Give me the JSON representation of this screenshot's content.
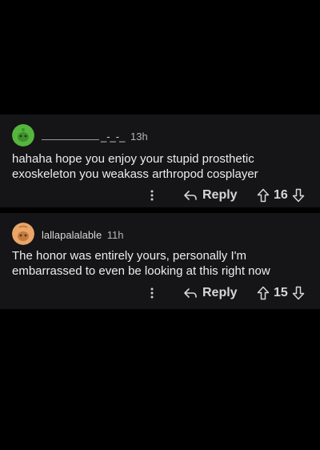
{
  "comments": [
    {
      "username": "_-_-_",
      "age": "13h",
      "text": "hahaha hope you enjoy your stupid prosthetic exoskeleton you weakass arthropod cosplayer",
      "reply_label": "Reply",
      "score": "16",
      "avatar_color": "#55b53d"
    },
    {
      "username": "lallapalalable",
      "age": "11h",
      "text": "The honor was entirely yours, personally I'm embarrassed to even be looking at this right now",
      "reply_label": "Reply",
      "score": "15",
      "avatar_color": "#e9a668"
    }
  ],
  "icons": {
    "more": "vertical-dots-icon",
    "reply": "reply-arrow-icon",
    "upvote": "upvote-arrow-icon",
    "downvote": "downvote-arrow-icon"
  }
}
